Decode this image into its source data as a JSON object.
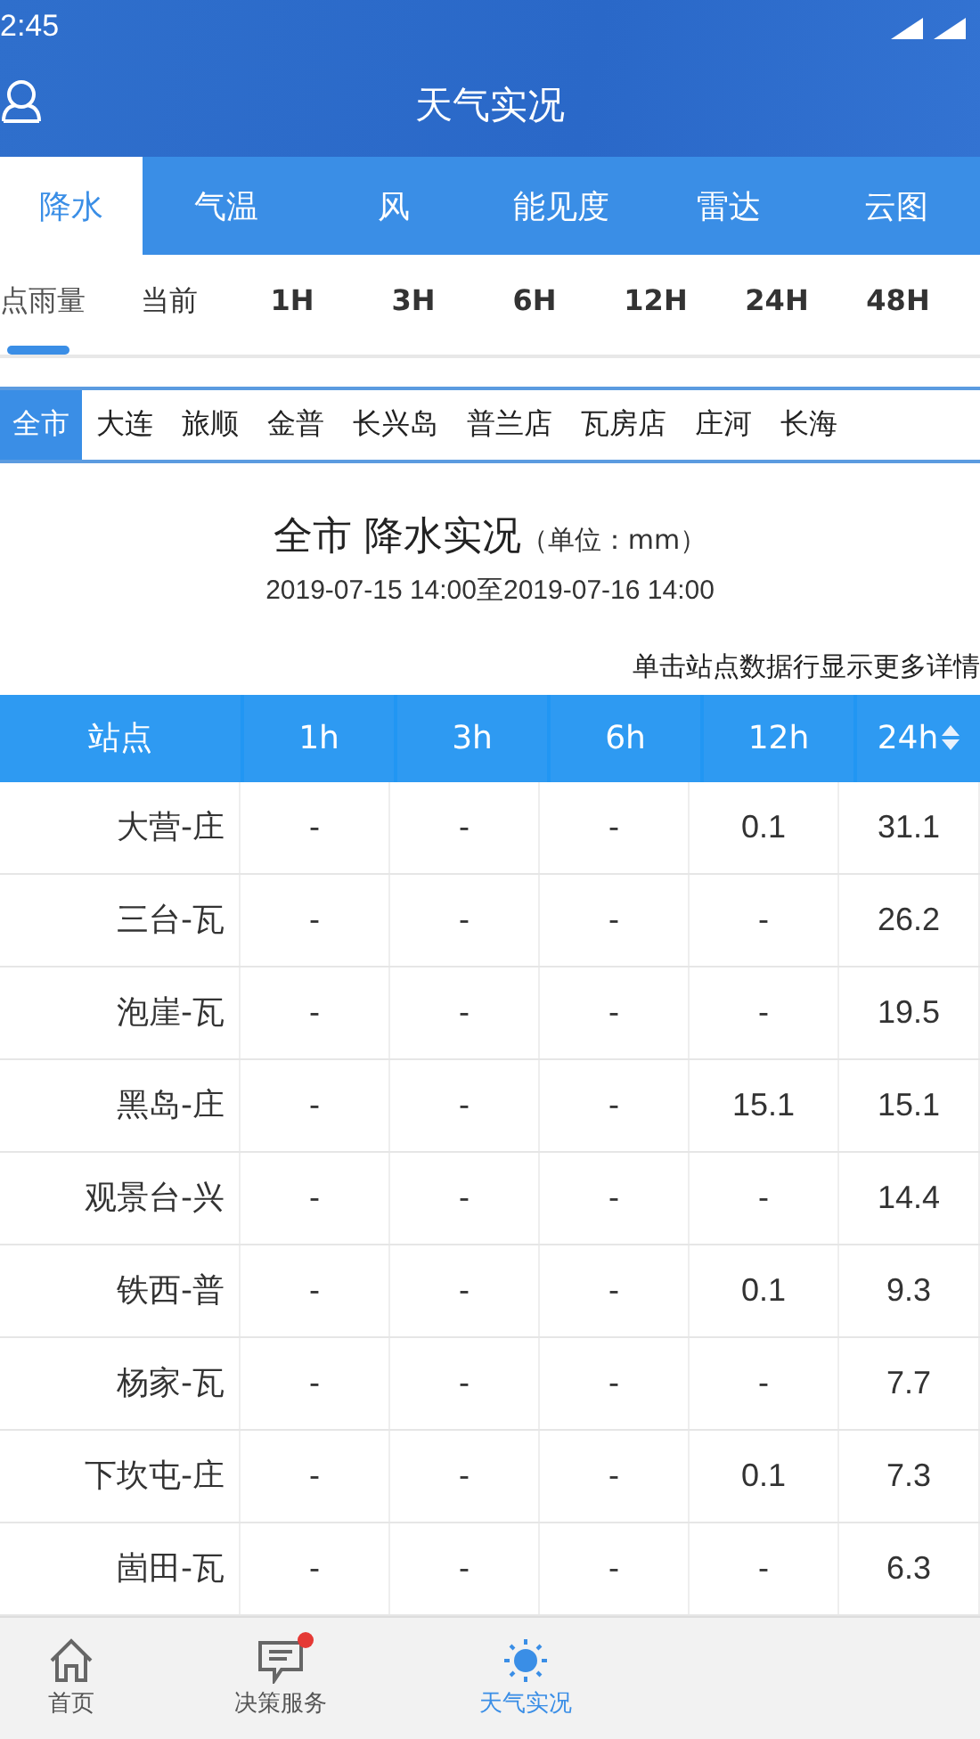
{
  "status_bar": {
    "time": "2:45"
  },
  "header": {
    "title": "天气实况"
  },
  "tabs": [
    {
      "label": "降水",
      "selected": true
    },
    {
      "label": "气温",
      "selected": false
    },
    {
      "label": "风",
      "selected": false
    },
    {
      "label": "能见度",
      "selected": false
    },
    {
      "label": "雷达",
      "selected": false
    },
    {
      "label": "云图",
      "selected": false
    }
  ],
  "sub_tabs": [
    {
      "label": "点雨量",
      "selected": true
    },
    {
      "label": "当前",
      "selected": false
    },
    {
      "label": "1H",
      "selected": false
    },
    {
      "label": "3H",
      "selected": false
    },
    {
      "label": "6H",
      "selected": false
    },
    {
      "label": "12H",
      "selected": false
    },
    {
      "label": "24H",
      "selected": false
    },
    {
      "label": "48H",
      "selected": false
    }
  ],
  "regions": [
    {
      "label": "全市",
      "selected": true
    },
    {
      "label": "大连",
      "selected": false
    },
    {
      "label": "旅顺",
      "selected": false
    },
    {
      "label": "金普",
      "selected": false
    },
    {
      "label": "长兴岛",
      "selected": false
    },
    {
      "label": "普兰店",
      "selected": false
    },
    {
      "label": "瓦房店",
      "selected": false
    },
    {
      "label": "庄河",
      "selected": false
    },
    {
      "label": "长海",
      "selected": false
    }
  ],
  "report": {
    "title": "全市 降水实况",
    "unit": "（单位：mm）",
    "period": "2019-07-15 14:00至2019-07-16 14:00",
    "hint": "单击站点数据行显示更多详情"
  },
  "table": {
    "columns": [
      {
        "label": "站点",
        "sortable": false
      },
      {
        "label": "1h",
        "sortable": false
      },
      {
        "label": "3h",
        "sortable": false
      },
      {
        "label": "6h",
        "sortable": false
      },
      {
        "label": "12h",
        "sortable": false
      },
      {
        "label": "24h",
        "sortable": true
      }
    ],
    "rows": [
      [
        "大营-庄",
        "-",
        "-",
        "-",
        "0.1",
        "31.1"
      ],
      [
        "三台-瓦",
        "-",
        "-",
        "-",
        "-",
        "26.2"
      ],
      [
        "泡崖-瓦",
        "-",
        "-",
        "-",
        "-",
        "19.5"
      ],
      [
        "黑岛-庄",
        "-",
        "-",
        "-",
        "15.1",
        "15.1"
      ],
      [
        "观景台-兴",
        "-",
        "-",
        "-",
        "-",
        "14.4"
      ],
      [
        "铁西-普",
        "-",
        "-",
        "-",
        "0.1",
        "9.3"
      ],
      [
        "杨家-瓦",
        "-",
        "-",
        "-",
        "-",
        "7.7"
      ],
      [
        "下坎屯-庄",
        "-",
        "-",
        "-",
        "0.1",
        "7.3"
      ],
      [
        "崮田-瓦",
        "-",
        "-",
        "-",
        "-",
        "6.3"
      ]
    ]
  },
  "bottom_nav": [
    {
      "kind": "home",
      "label": "首页",
      "selected": false,
      "badge": false
    },
    {
      "kind": "chat",
      "label": "决策服务",
      "selected": false,
      "badge": true
    },
    {
      "kind": "sun",
      "label": "天气实况",
      "selected": true,
      "badge": false
    }
  ]
}
